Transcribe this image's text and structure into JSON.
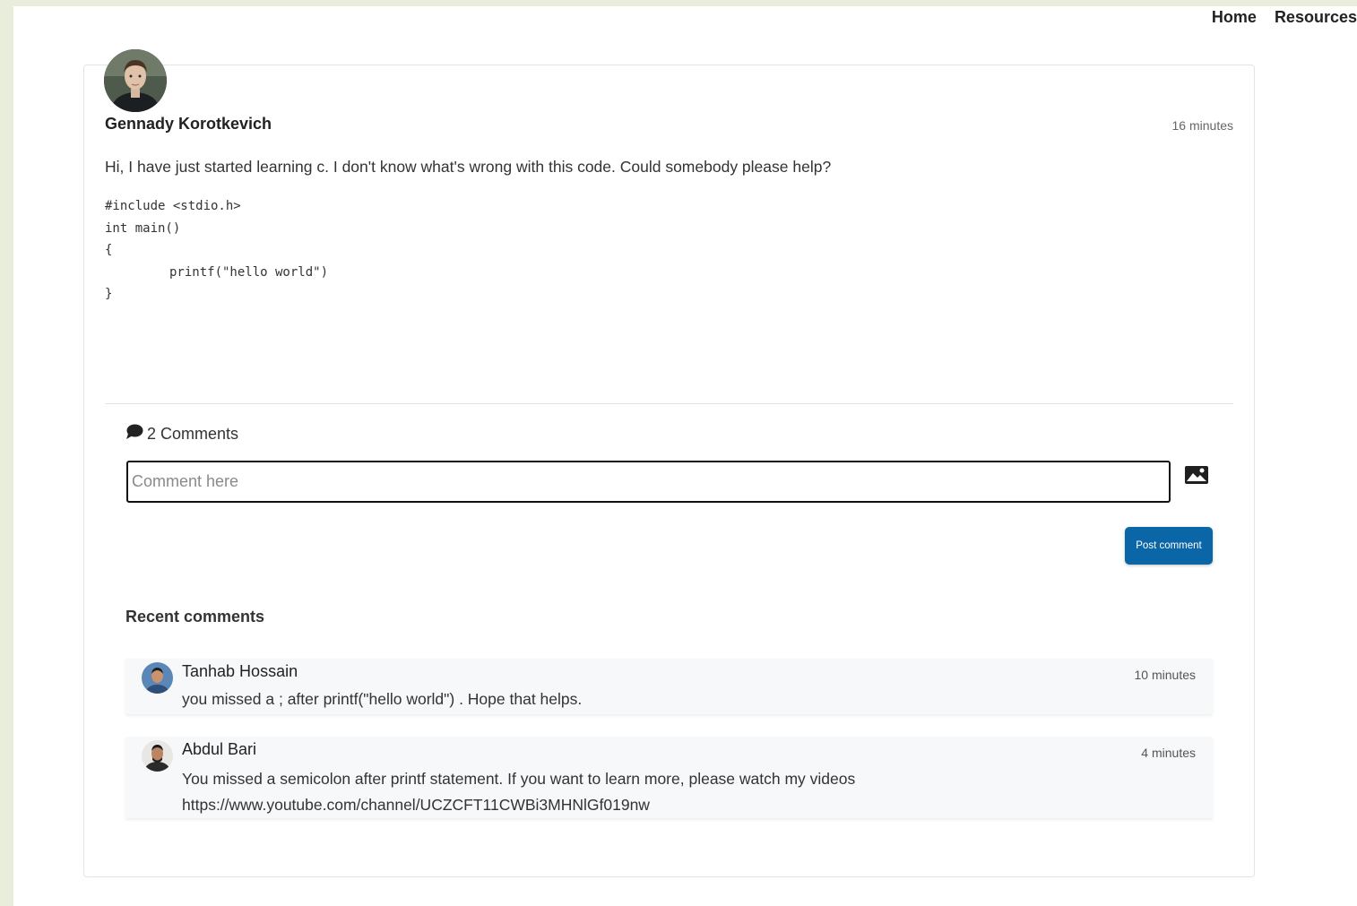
{
  "nav": {
    "home": "Home",
    "resources": "Resources"
  },
  "post": {
    "author": "Gennady Korotkevich",
    "time": "16 minutes",
    "text": "Hi, I have just started learning c. I don't know what's wrong with this code. Could somebody please help?",
    "code_lines": [
      "#include <stdio.h>",
      "int main()",
      "{",
      "printf(\"hello world\")",
      "}"
    ]
  },
  "comments_section": {
    "count_label": "2 Comments",
    "input_placeholder": "Comment here",
    "post_button": "Post comment",
    "recent_title": "Recent comments"
  },
  "comments": [
    {
      "author": "Tanhab Hossain",
      "time": "10 minutes",
      "text_lines": [
        "you missed a ; after printf(\"hello world\") . Hope that helps."
      ]
    },
    {
      "author": "Abdul Bari",
      "time": "4 minutes",
      "text_lines": [
        "You missed a semicolon after printf statement. If you want to learn more, please watch my videos",
        "https://www.youtube.com/channel/UCZCFT11CWBi3MHNlGf019nw"
      ]
    }
  ],
  "colors": {
    "accent": "#0b66a7",
    "background": "#e9eddc"
  },
  "icons": {
    "comment": "comment-bubble-icon",
    "image_upload": "image-icon"
  }
}
